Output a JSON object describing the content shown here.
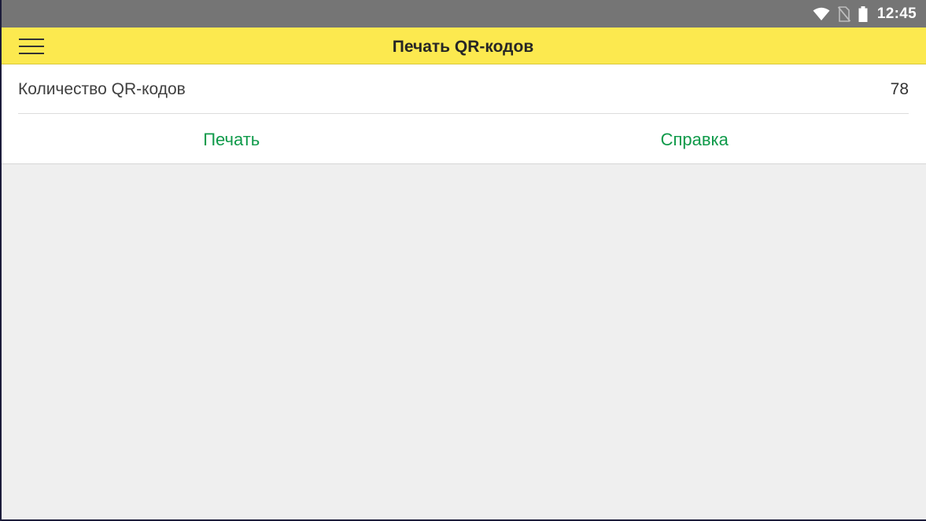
{
  "status_bar": {
    "time": "12:45",
    "icons": [
      "wifi-icon",
      "no-sim-icon",
      "battery-icon"
    ]
  },
  "app_bar": {
    "menu_icon": "hamburger-menu-icon",
    "title": "Печать QR-кодов",
    "background_color": "#fce94f"
  },
  "form": {
    "qr_count": {
      "label": "Количество QR-кодов",
      "value": "78"
    },
    "actions": {
      "print_label": "Печать",
      "help_label": "Справка",
      "color": "#0f9a4a"
    }
  }
}
